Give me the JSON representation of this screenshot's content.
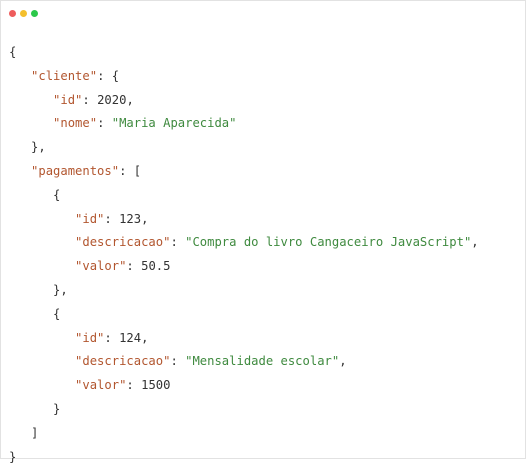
{
  "window": {
    "colors": {
      "close": "#ee5c5c",
      "minimize": "#f4bf2c",
      "maximize": "#2bc84a",
      "key": "#b2562f",
      "string": "#3f8a3f",
      "punctuation": "#333333"
    }
  },
  "code": {
    "lines": [
      {
        "indent": "",
        "parts": [
          {
            "t": "p",
            "v": "{"
          }
        ]
      },
      {
        "indent": "   ",
        "parts": [
          {
            "t": "k",
            "v": "\"cliente\""
          },
          {
            "t": "p",
            "v": ": {"
          }
        ]
      },
      {
        "indent": "      ",
        "parts": [
          {
            "t": "k",
            "v": "\"id\""
          },
          {
            "t": "p",
            "v": ": "
          },
          {
            "t": "n",
            "v": "2020"
          },
          {
            "t": "p",
            "v": ","
          }
        ]
      },
      {
        "indent": "      ",
        "parts": [
          {
            "t": "k",
            "v": "\"nome\""
          },
          {
            "t": "p",
            "v": ": "
          },
          {
            "t": "s",
            "v": "\"Maria Aparecida\""
          }
        ]
      },
      {
        "indent": "   ",
        "parts": [
          {
            "t": "p",
            "v": "},"
          }
        ]
      },
      {
        "indent": "   ",
        "parts": [
          {
            "t": "k",
            "v": "\"pagamentos\""
          },
          {
            "t": "p",
            "v": ": ["
          }
        ]
      },
      {
        "indent": "      ",
        "parts": [
          {
            "t": "p",
            "v": "{"
          }
        ]
      },
      {
        "indent": "         ",
        "parts": [
          {
            "t": "k",
            "v": "\"id\""
          },
          {
            "t": "p",
            "v": ": "
          },
          {
            "t": "n",
            "v": "123"
          },
          {
            "t": "p",
            "v": ","
          }
        ]
      },
      {
        "indent": "         ",
        "parts": [
          {
            "t": "k",
            "v": "\"descricacao\""
          },
          {
            "t": "p",
            "v": ": "
          },
          {
            "t": "s",
            "v": "\"Compra do livro Cangaceiro JavaScript\""
          },
          {
            "t": "p",
            "v": ","
          }
        ]
      },
      {
        "indent": "         ",
        "parts": [
          {
            "t": "k",
            "v": "\"valor\""
          },
          {
            "t": "p",
            "v": ": "
          },
          {
            "t": "n",
            "v": "50.5"
          }
        ]
      },
      {
        "indent": "      ",
        "parts": [
          {
            "t": "p",
            "v": "},"
          }
        ]
      },
      {
        "indent": "      ",
        "parts": [
          {
            "t": "p",
            "v": "{"
          }
        ]
      },
      {
        "indent": "         ",
        "parts": [
          {
            "t": "k",
            "v": "\"id\""
          },
          {
            "t": "p",
            "v": ": "
          },
          {
            "t": "n",
            "v": "124"
          },
          {
            "t": "p",
            "v": ","
          }
        ]
      },
      {
        "indent": "         ",
        "parts": [
          {
            "t": "k",
            "v": "\"descricacao\""
          },
          {
            "t": "p",
            "v": ": "
          },
          {
            "t": "s",
            "v": "\"Mensalidade escolar\""
          },
          {
            "t": "p",
            "v": ","
          }
        ]
      },
      {
        "indent": "         ",
        "parts": [
          {
            "t": "k",
            "v": "\"valor\""
          },
          {
            "t": "p",
            "v": ": "
          },
          {
            "t": "n",
            "v": "1500"
          }
        ]
      },
      {
        "indent": "      ",
        "parts": [
          {
            "t": "p",
            "v": "}"
          }
        ]
      },
      {
        "indent": "   ",
        "parts": [
          {
            "t": "p",
            "v": "]"
          }
        ]
      },
      {
        "indent": "",
        "parts": [
          {
            "t": "p",
            "v": "}"
          }
        ]
      }
    ]
  }
}
